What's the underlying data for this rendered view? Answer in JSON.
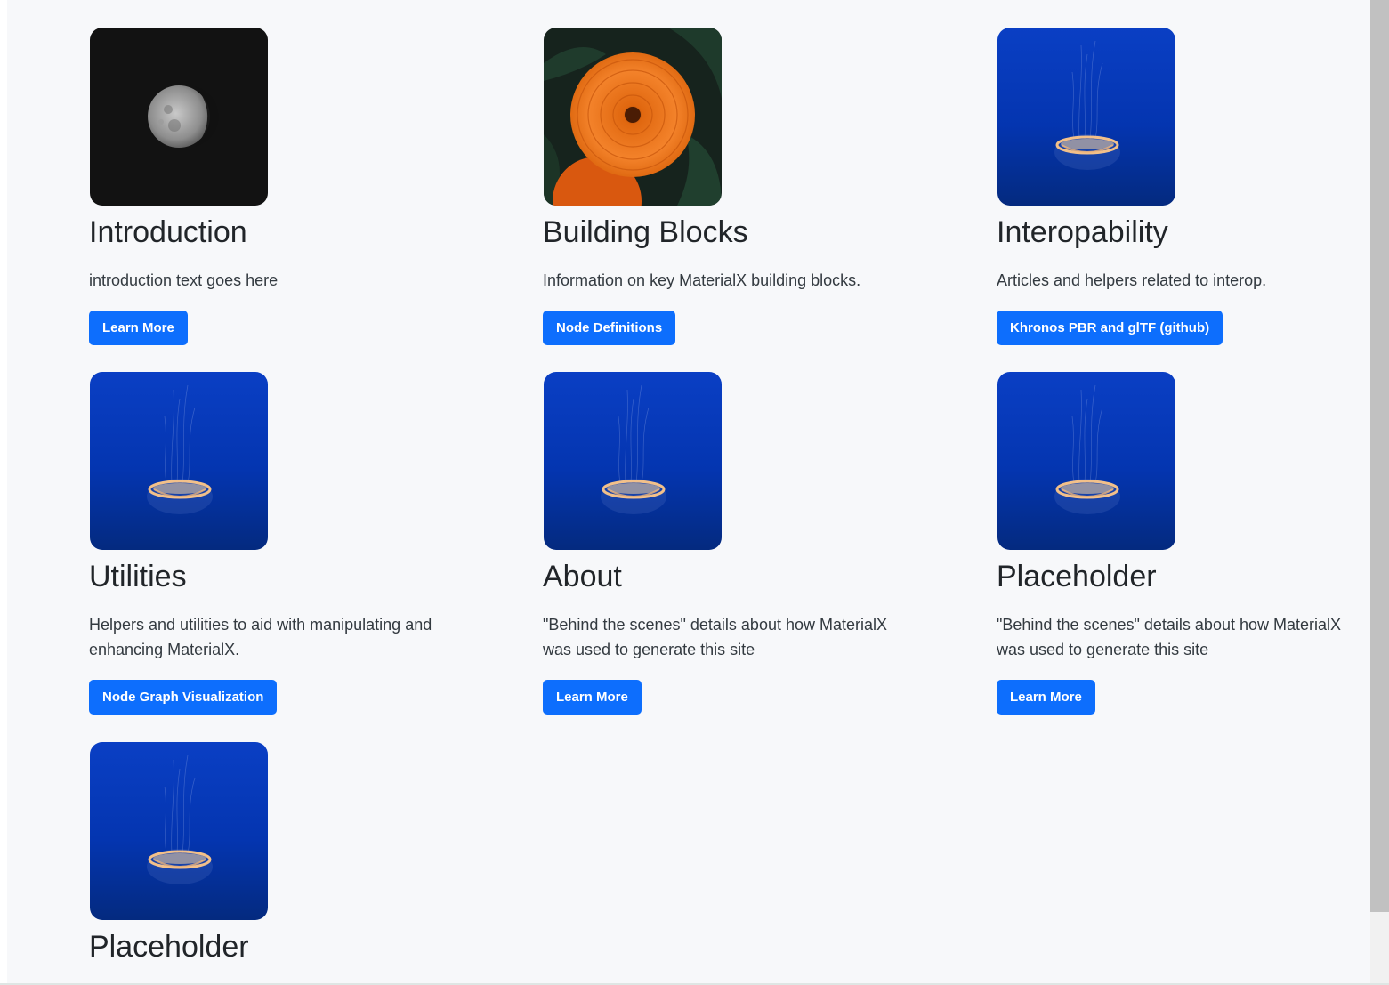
{
  "cards": [
    {
      "image": "moon-image",
      "title": "Introduction",
      "text": "introduction text goes here",
      "button": "Learn More"
    },
    {
      "image": "orange-flower-image",
      "title": "Building Blocks",
      "text": "Information on key MaterialX building blocks.",
      "button": "Node Definitions"
    },
    {
      "image": "jellyfish-image",
      "title": "Interopability",
      "text": "Articles and helpers related to interop.",
      "button": "Khronos PBR and glTF (github)"
    },
    {
      "image": "jellyfish-image",
      "title": "Utilities",
      "text": "Helpers and utilities to aid with manipulating and enhancing MaterialX.",
      "button": "Node Graph Visualization"
    },
    {
      "image": "jellyfish-image",
      "title": "About",
      "text": "\"Behind the scenes\" details about how MaterialX was used to generate this site",
      "button": "Learn More"
    },
    {
      "image": "jellyfish-image",
      "title": "Placeholder",
      "text": "\"Behind the scenes\" details about how MaterialX was used to generate this site",
      "button": "Learn More"
    },
    {
      "image": "jellyfish-image",
      "title": "Placeholder"
    }
  ],
  "colors": {
    "page_background": "#f7f8fa",
    "button": "#0d6efd",
    "title": "#212529",
    "text": "#333a40"
  }
}
